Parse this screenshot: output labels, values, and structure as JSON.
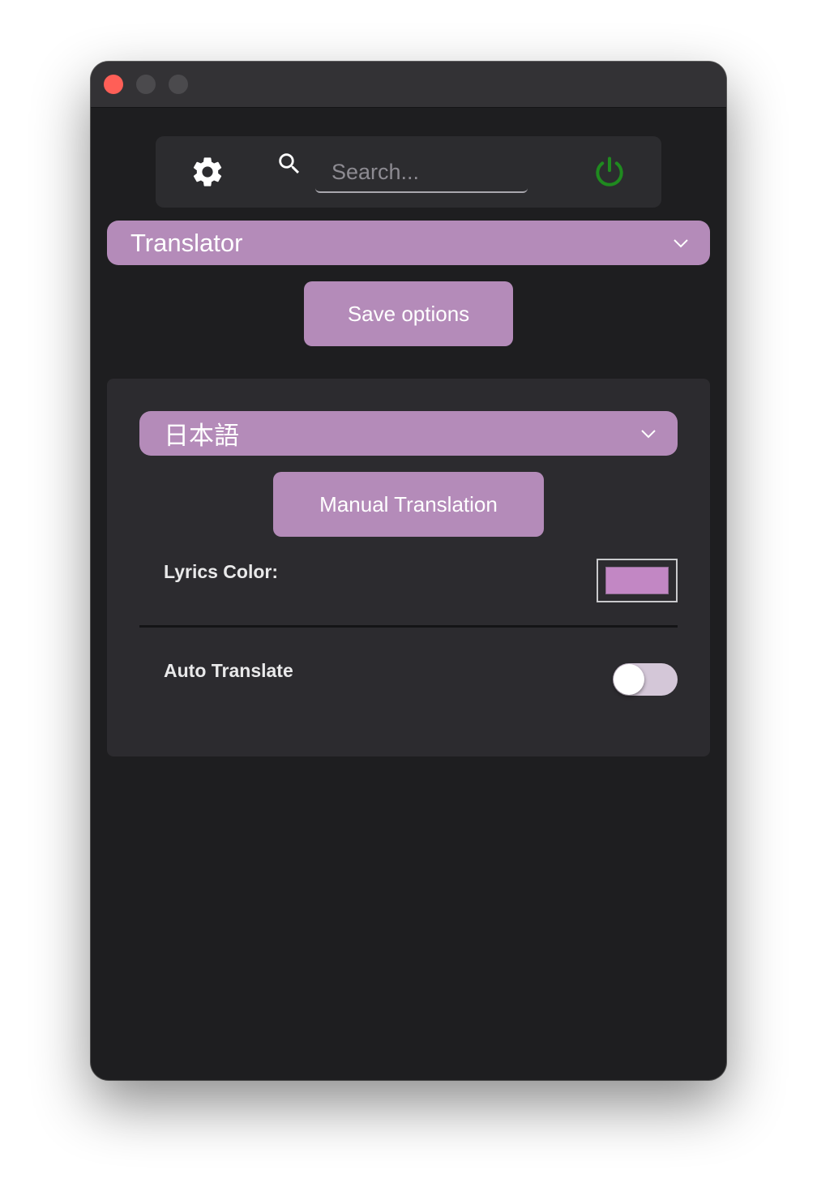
{
  "window": {
    "controls": [
      "close",
      "minimize",
      "maximize"
    ]
  },
  "topbar": {
    "settings_icon": "gear-icon",
    "search_icon": "search-icon",
    "search_placeholder": "Search...",
    "search_value": "",
    "power_icon": "power-icon",
    "power_color": "#1f8a1f"
  },
  "module_select": {
    "selected": "Translator",
    "icon": "chevron-down-icon"
  },
  "save_button": {
    "label": "Save options"
  },
  "panel": {
    "language_select": {
      "selected": "日本語",
      "icon": "chevron-down-icon"
    },
    "manual_button": {
      "label": "Manual Translation"
    },
    "lyrics_color": {
      "label": "Lyrics Color:",
      "value": "#c287c4"
    },
    "auto_translate": {
      "label": "Auto Translate",
      "enabled": false
    }
  },
  "colors": {
    "accent": "#b48bb9",
    "background": "#1e1e20",
    "panel": "#2c2b2f"
  }
}
